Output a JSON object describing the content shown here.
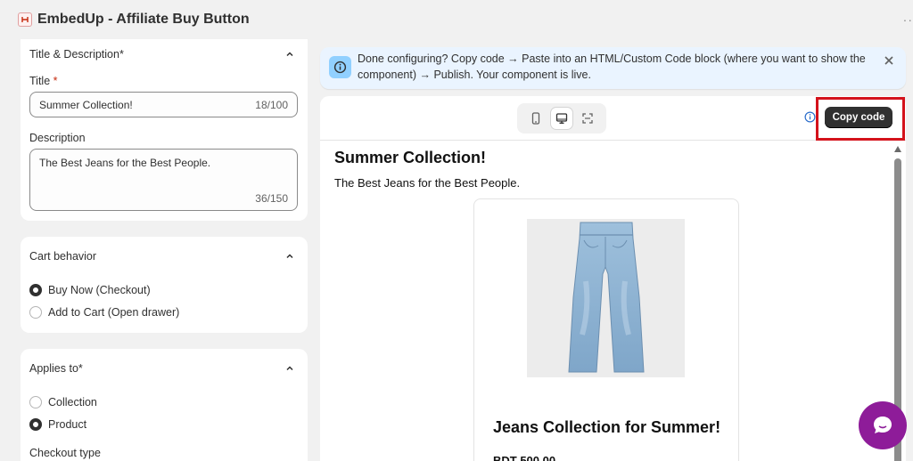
{
  "app": {
    "title": "EmbedUp - Affiliate Buy Button",
    "more": "··"
  },
  "title_section": {
    "heading": "Title & Description*",
    "title_label": "Title",
    "required_mark": "*",
    "title_value": "Summer Collection!",
    "title_count": "18/100",
    "description_label": "Description",
    "description_value": "The Best Jeans for the Best People.",
    "description_count": "36/150"
  },
  "cart_section": {
    "heading": "Cart behavior",
    "options": [
      {
        "label": "Buy Now (Checkout)",
        "selected": true
      },
      {
        "label": "Add to Cart (Open drawer)",
        "selected": false
      }
    ]
  },
  "applies_section": {
    "heading": "Applies to*",
    "options": [
      {
        "label": "Collection",
        "selected": false
      },
      {
        "label": "Product",
        "selected": true
      }
    ],
    "checkout_type_label": "Checkout type"
  },
  "banner": {
    "text": "Done configuring? Copy code → Paste into an HTML/Custom Code block (where you want to show the component) → Publish. Your component is live."
  },
  "preview": {
    "copy_button": "Copy code",
    "active_view": "desktop",
    "embed_title": "Summer Collection!",
    "embed_description": "The Best Jeans for the Best People.",
    "product_title": "Jeans Collection for Summer!",
    "product_price": "BDT 500.00"
  },
  "colors": {
    "accent_dark": "#303030",
    "highlight": "#d4121b",
    "banner_bg": "#eaf4ff",
    "chat": "#8e1c99"
  },
  "icons": [
    "info-icon",
    "close-icon",
    "mobile-icon",
    "desktop-icon",
    "fullscreen-icon",
    "chevron-up-icon",
    "chat-icon"
  ]
}
